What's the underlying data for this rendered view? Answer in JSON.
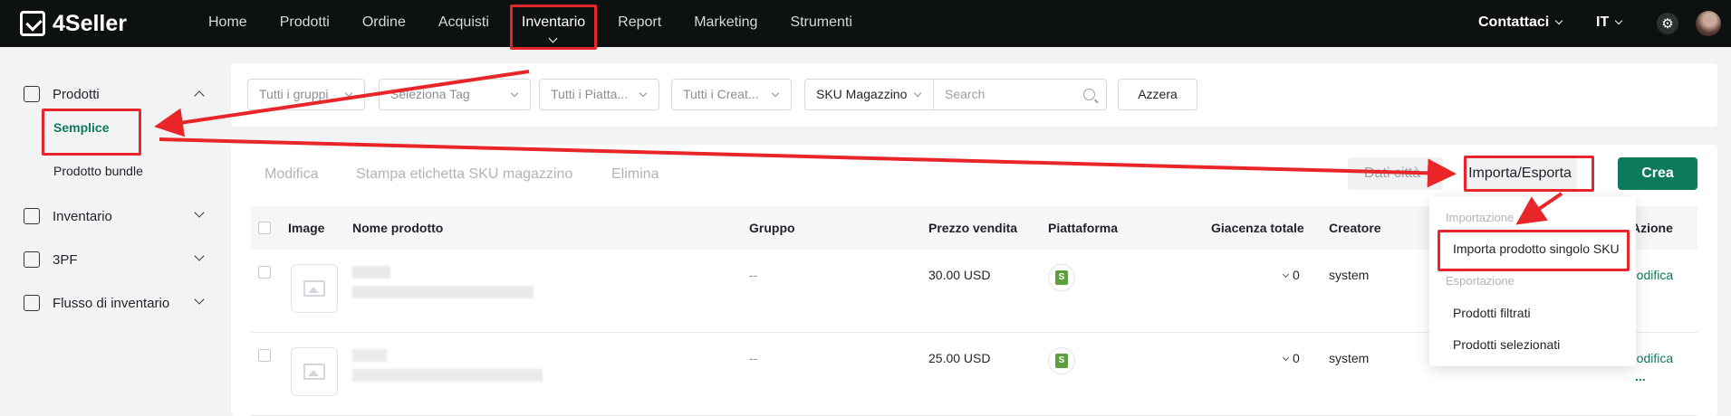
{
  "brand": {
    "logo_text": "4Seller"
  },
  "nav": {
    "items": [
      "Home",
      "Prodotti",
      "Ordine",
      "Acquisti",
      "Inventario",
      "Report",
      "Marketing",
      "Strumenti"
    ],
    "active": "Inventario",
    "contact": "Contattaci",
    "language": "IT"
  },
  "sidebar": {
    "groups": [
      {
        "label": "Prodotti",
        "icon": "tag-icon",
        "expanded": true,
        "children": [
          "Semplice",
          "Prodotto bundle"
        ],
        "active_child": "Semplice"
      },
      {
        "label": "Inventario",
        "icon": "warehouse-icon",
        "expanded": false
      },
      {
        "label": "3PF",
        "icon": "box-icon",
        "expanded": false
      },
      {
        "label": "Flusso di inventario",
        "icon": "flow-icon",
        "expanded": false
      }
    ]
  },
  "filters": {
    "groups": "Tutti i gruppi",
    "tags": "Seleziona Tag",
    "platforms": "Tutti i Piatta...",
    "creators": "Tutti i Creat...",
    "search_field": "SKU Magazzino",
    "search_placeholder": "Search",
    "reset": "Azzera"
  },
  "toolbar": {
    "edit": "Modifica",
    "print": "Stampa etichetta SKU magazzino",
    "delete": "Elimina",
    "other_button": "Dati città",
    "import_export": "Importa/Esporta",
    "create": "Crea"
  },
  "table": {
    "headers": [
      "Image",
      "Nome prodotto",
      "Gruppo",
      "Prezzo vendita",
      "Piattaforma",
      "Giacenza totale",
      "Creatore",
      "Azione"
    ],
    "rows": [
      {
        "group": "--",
        "price": "30.00 USD",
        "platform": "shopify-icon",
        "stock": "0",
        "creator": "system",
        "action": "Modifica"
      },
      {
        "group": "--",
        "price": "25.00 USD",
        "platform": "shopify-icon",
        "stock": "0",
        "creator": "system",
        "action": "Modifica",
        "more": "..."
      }
    ]
  },
  "dropdown": {
    "import_header": "Importazione",
    "import_items": [
      "Importa prodotto singolo SKU"
    ],
    "export_header": "Esportazione",
    "export_items": [
      "Prodotti filtrati",
      "Prodotti selezionati"
    ]
  },
  "annotation_color": "#e8262a",
  "accent_color": "#0e7a5c"
}
